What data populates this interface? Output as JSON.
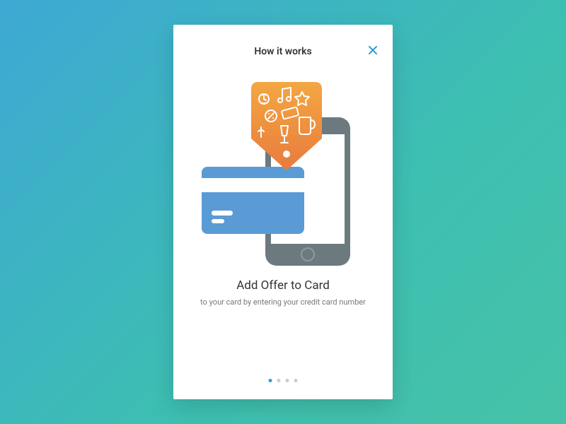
{
  "header": {
    "title": "How it works"
  },
  "step": {
    "title": "Add Offer to Card",
    "description": "to your card by entering your credit card number"
  },
  "pagination": {
    "total": 4,
    "active_index": 0
  },
  "colors": {
    "accent": "#2A9FD6",
    "card_blue": "#5A9BD5",
    "phone_grey": "#6C7A80",
    "tag_gradient_top": "#F4A742",
    "tag_gradient_bottom": "#E87B3E"
  }
}
